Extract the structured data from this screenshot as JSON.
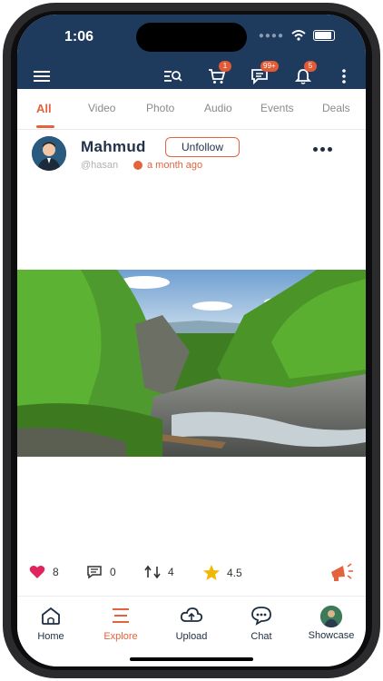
{
  "status": {
    "time": "1:06"
  },
  "header": {
    "cart_badge": "1",
    "messages_badge": "99+",
    "notifications_badge": "5"
  },
  "tabs": [
    "All",
    "Video",
    "Photo",
    "Audio",
    "Events",
    "Deals"
  ],
  "post": {
    "author": "Mahmud",
    "follow_label": "Unfollow",
    "handle": "@hasan",
    "posted": "a month ago",
    "likes": "8",
    "comments": "0",
    "shares": "4",
    "rating": "4.5"
  },
  "nav": [
    {
      "label": "Home",
      "icon": "home-icon"
    },
    {
      "label": "Explore",
      "icon": "explore-icon"
    },
    {
      "label": "Upload",
      "icon": "upload-cloud-icon"
    },
    {
      "label": "Chat",
      "icon": "chat-icon"
    },
    {
      "label": "Showcase",
      "icon": "showcase-avatar"
    }
  ],
  "colors": {
    "header": "#1e3a5c",
    "accent": "#e2633e",
    "like": "#e0245e",
    "star": "#f2b705"
  }
}
